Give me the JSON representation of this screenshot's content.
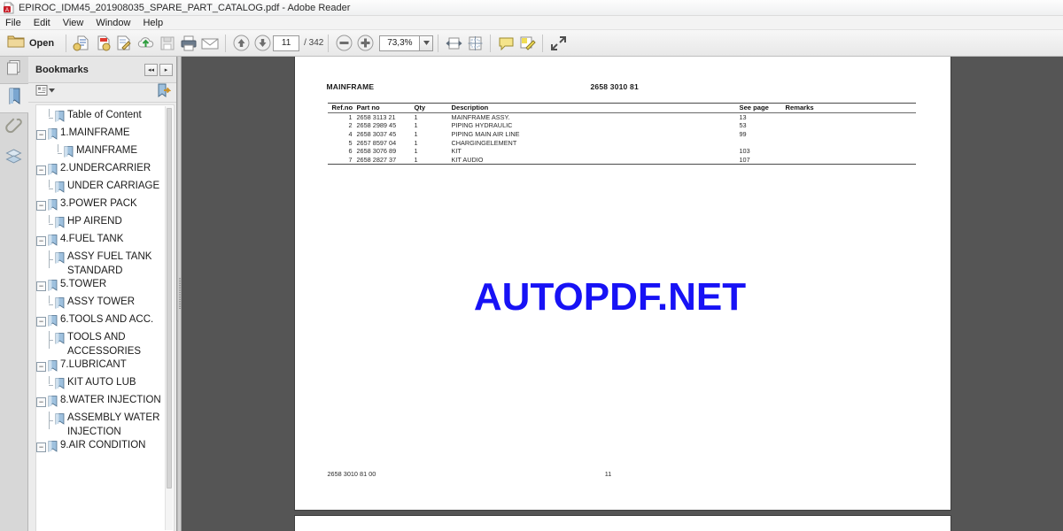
{
  "window": {
    "title": "EPIROC_IDM45_201908035_SPARE_PART_CATALOG.pdf - Adobe Reader",
    "app_icon": "pdf-document-icon"
  },
  "menubar": {
    "items": [
      {
        "label": "File"
      },
      {
        "label": "Edit"
      },
      {
        "label": "View"
      },
      {
        "label": "Window"
      },
      {
        "label": "Help"
      }
    ]
  },
  "toolbar": {
    "open_label": "Open",
    "open_icon": "folder-open-icon",
    "buttons": [
      {
        "name": "create-pdf-icon"
      },
      {
        "name": "combine-files-icon"
      },
      {
        "name": "sign-document-icon"
      },
      {
        "name": "upload-cloud-icon"
      },
      {
        "name": "save-disk-icon"
      },
      {
        "name": "print-icon"
      },
      {
        "name": "email-envelope-icon"
      },
      {
        "name": "previous-page-icon"
      },
      {
        "name": "next-page-icon"
      },
      {
        "name": "zoom-out-icon"
      },
      {
        "name": "zoom-in-icon"
      },
      {
        "name": "fit-width-icon"
      },
      {
        "name": "fit-page-icon"
      },
      {
        "name": "add-sticky-note-icon"
      },
      {
        "name": "highlight-text-icon"
      },
      {
        "name": "read-mode-icon"
      }
    ],
    "page_current": "11",
    "page_total": "/ 342",
    "zoom_value": "73,3%"
  },
  "rail": {
    "items": [
      {
        "name": "page-thumbnails-icon",
        "active": false
      },
      {
        "name": "bookmarks-icon",
        "active": true
      },
      {
        "name": "attachments-paperclip-icon",
        "active": false
      },
      {
        "name": "layers-icon",
        "active": false
      }
    ]
  },
  "bookmarks_panel": {
    "title": "Bookmarks",
    "nav_prev_label": "◂◂",
    "nav_next_label": "▸",
    "options_icon": "bookmark-options-menu-icon",
    "new_bookmark_icon": "new-bookmark-icon",
    "items": [
      {
        "label": "Table of Content",
        "level": 1,
        "expandable": false
      },
      {
        "label": "1.MAINFRAME",
        "level": 0,
        "expandable": true,
        "expander": "−"
      },
      {
        "label": "MAINFRAME",
        "level": 2,
        "expandable": false
      },
      {
        "label": "2.UNDERCARRIER",
        "level": 0,
        "expandable": true,
        "expander": "−"
      },
      {
        "label": "UNDER CARRIAGE",
        "level": 1,
        "expandable": false
      },
      {
        "label": "3.POWER PACK",
        "level": 0,
        "expandable": true,
        "expander": "−"
      },
      {
        "label": "HP AIREND",
        "level": 1,
        "expandable": false
      },
      {
        "label": "4.FUEL TANK",
        "level": 0,
        "expandable": true,
        "expander": "−"
      },
      {
        "label": "ASSY FUEL TANK STANDARD",
        "level": 1,
        "expandable": false
      },
      {
        "label": "5.TOWER",
        "level": 0,
        "expandable": true,
        "expander": "−"
      },
      {
        "label": "ASSY TOWER",
        "level": 1,
        "expandable": false
      },
      {
        "label": "6.TOOLS AND ACC.",
        "level": 0,
        "expandable": true,
        "expander": "−"
      },
      {
        "label": "TOOLS AND ACCESSORIES",
        "level": 1,
        "expandable": false
      },
      {
        "label": "7.LUBRICANT",
        "level": 0,
        "expandable": true,
        "expander": "−"
      },
      {
        "label": "KIT AUTO LUB",
        "level": 1,
        "expandable": false
      },
      {
        "label": "8.WATER INJECTION",
        "level": 0,
        "expandable": true,
        "expander": "−"
      },
      {
        "label": "ASSEMBLY WATER INJECTION",
        "level": 1,
        "expandable": false
      },
      {
        "label": "9.AIR CONDITION",
        "level": 0,
        "expandable": true,
        "expander": "−"
      }
    ]
  },
  "document": {
    "header_title": "MAINFRAME",
    "header_number": "2658 3010 81",
    "watermark": "AUTOPDF.NET",
    "watermark_color": "#1712f5",
    "footer_left": "2658 3010 81 00",
    "footer_center": "11",
    "table": {
      "columns": [
        "Ref.no",
        "Part no",
        "Qty",
        "Description",
        "See page",
        "Remarks"
      ],
      "rows": [
        {
          "ref": "1",
          "part": "2658 3113 21",
          "qty": "1",
          "desc": "MAINFRAME ASSY.",
          "see_page": "13",
          "remarks": ""
        },
        {
          "ref": "2",
          "part": "2658 2989 45",
          "qty": "1",
          "desc": "PIPING HYDRAULIC",
          "see_page": "53",
          "remarks": ""
        },
        {
          "ref": "4",
          "part": "2658 3037 45",
          "qty": "1",
          "desc": "PIPING MAIN AIR LINE",
          "see_page": "99",
          "remarks": ""
        },
        {
          "ref": "5",
          "part": "2657 8597 04",
          "qty": "1",
          "desc": "CHARGINGELEMENT",
          "see_page": "",
          "remarks": ""
        },
        {
          "ref": "6",
          "part": "2658 3076 89",
          "qty": "1",
          "desc": "KIT",
          "see_page": "103",
          "remarks": ""
        },
        {
          "ref": "7",
          "part": "2658 2827 37",
          "qty": "1",
          "desc": "KIT AUDIO",
          "see_page": "107",
          "remarks": ""
        }
      ]
    }
  }
}
